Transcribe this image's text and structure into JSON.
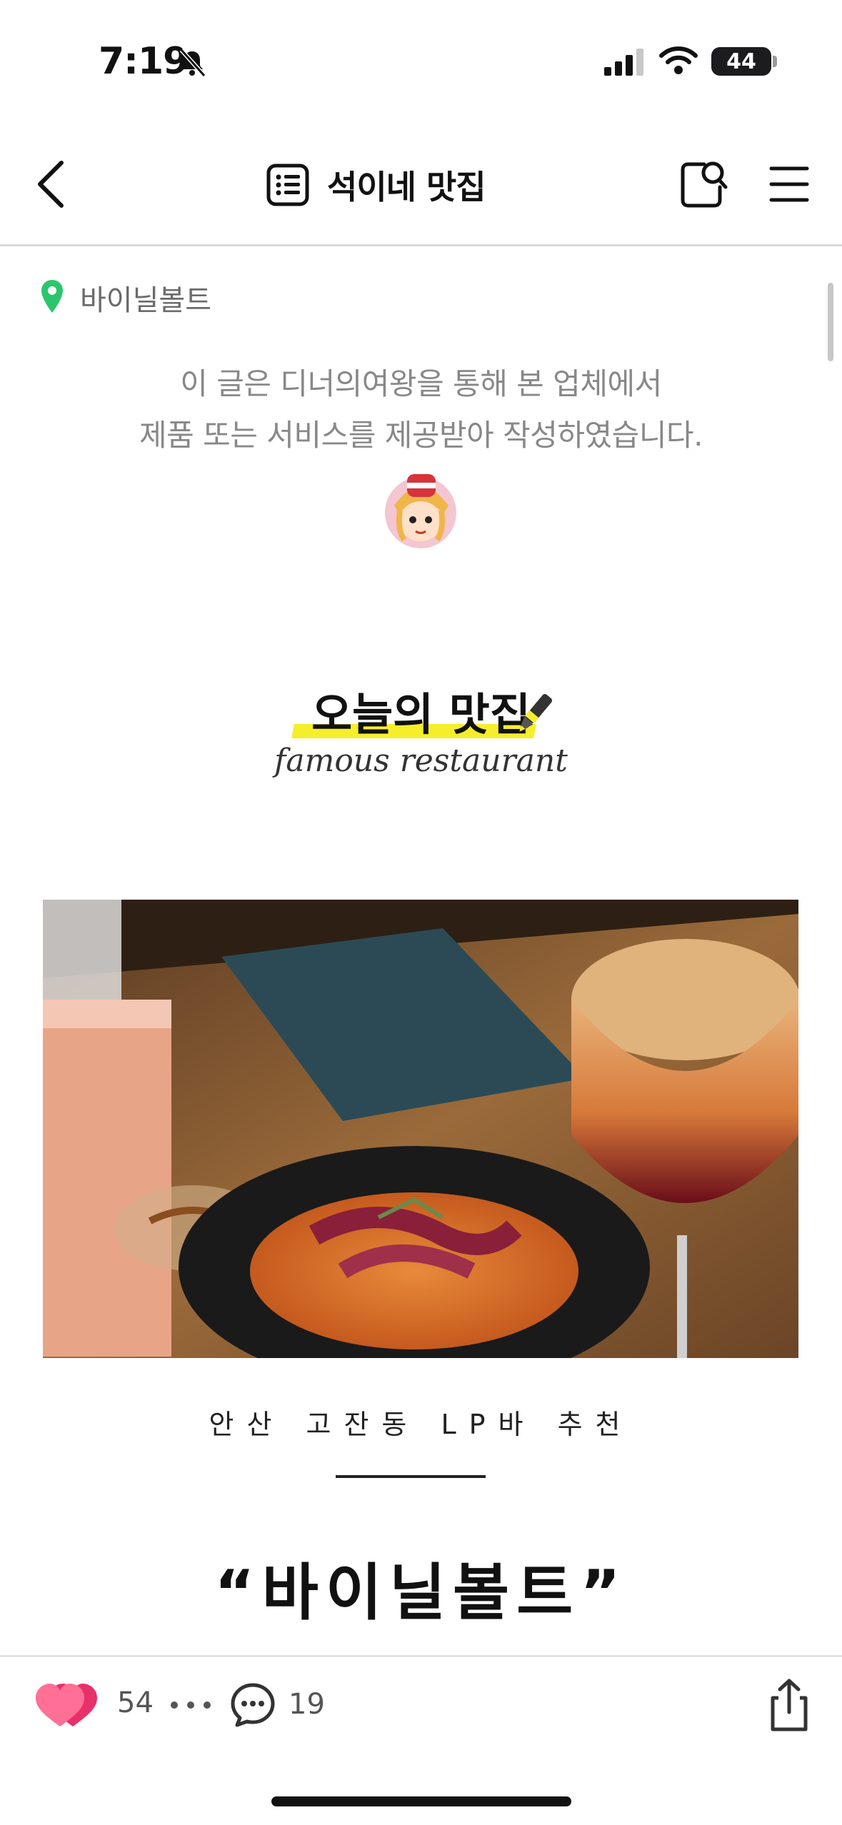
{
  "status": {
    "time": "7:19",
    "battery": "44"
  },
  "nav": {
    "title": "석이네 맛집"
  },
  "post": {
    "location": "바이닐볼트",
    "disclaimer_line1": "이 글은 디너의여왕을 통해 본 업체에서",
    "disclaimer_line2": "제품 또는 서비스를 제공받아 작성하였습니다.",
    "today_label": "오늘의 맛집",
    "today_sub": "famous restaurant",
    "subtitle": "안산 고잔동 LP바 추천",
    "headline": "“바이닐볼트”"
  },
  "footer": {
    "likes": "54",
    "comments": "19"
  },
  "colors": {
    "pin": "#2bc66b",
    "heart": "#ff4d7a",
    "highlight": "#f6ee2a"
  }
}
